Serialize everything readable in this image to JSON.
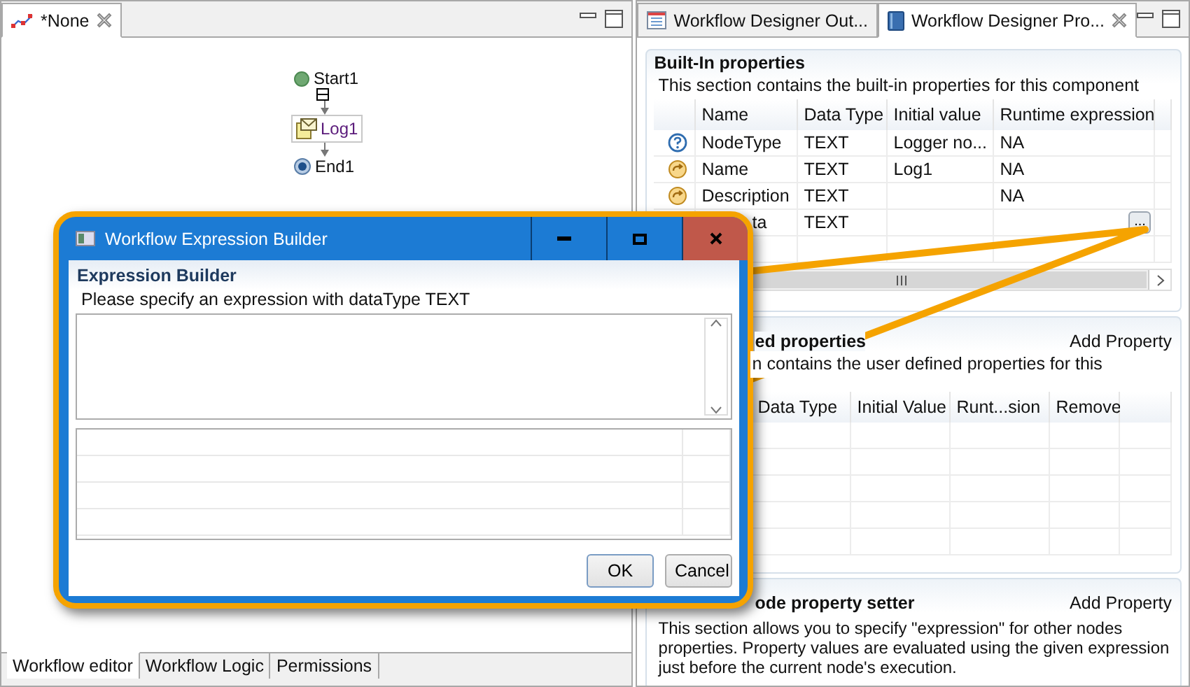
{
  "editor": {
    "tab": {
      "label": "*None"
    },
    "nodes": [
      {
        "kind": "start",
        "label": "Start1"
      },
      {
        "kind": "task",
        "label": "Log1"
      },
      {
        "kind": "end",
        "label": "End1"
      }
    ],
    "bottom_tabs": [
      {
        "label": "Workflow editor",
        "selected": true
      },
      {
        "label": "Workflow Logic",
        "selected": false
      },
      {
        "label": "Permissions",
        "selected": false
      }
    ]
  },
  "properties_view": {
    "tabs": [
      {
        "label": "Workflow Designer Out...",
        "kind": "outline",
        "selected": false
      },
      {
        "label": "Workflow Designer Pro...",
        "kind": "properties",
        "selected": true
      }
    ],
    "built_in": {
      "title": "Built-In properties",
      "description": "This section contains the built-in properties for this component",
      "columns": [
        "Name",
        "Data Type",
        "Initial value",
        "Runtime expression"
      ],
      "rows": [
        {
          "kind": "help",
          "name": "NodeType",
          "type": "TEXT",
          "value": "Logger no...",
          "expression": "NA"
        },
        {
          "kind": "arrow",
          "name": "Name",
          "type": "TEXT",
          "value": "Log1",
          "expression": "NA"
        },
        {
          "kind": "arrow",
          "name": "Description",
          "type": "TEXT",
          "expression": "NA"
        },
        {
          "name": "ta",
          "type": "TEXT",
          "action": "..."
        }
      ]
    },
    "user_defined": {
      "title": "ed properties",
      "action": "Add Property",
      "description": "n contains the user defined properties for this",
      "columns": [
        "Data Type",
        "Initial Value",
        "Runt...sion",
        "Remove"
      ]
    },
    "node_setter": {
      "title": "ode property setter",
      "action": "Add Property",
      "description": "This section allows you to specify \"expression\" for other nodes properties. Property values are evaluated using the given expression just before the current node's execution."
    }
  },
  "dialog": {
    "title": "Workflow Expression Builder",
    "heading": "Expression Builder",
    "prompt": "Please specify an expression with dataType TEXT",
    "buttons": [
      "OK",
      "Cancel"
    ]
  }
}
